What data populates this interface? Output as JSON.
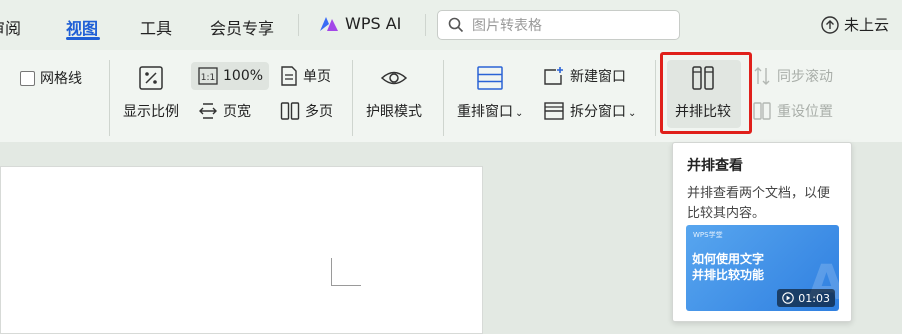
{
  "tabs": {
    "review_partial": "审阅",
    "view": "视图",
    "tools": "工具",
    "member": "会员专享",
    "wps_ai": "WPS AI"
  },
  "search": {
    "placeholder": "图片转表格"
  },
  "cloud": {
    "label": "未上云"
  },
  "ribbon": {
    "gridlines": "网格线",
    "zoom_ratio": "显示比例",
    "zoom_100": "100%",
    "page_width": "页宽",
    "single_page": "单页",
    "multi_page": "多页",
    "eye_protect": "护眼模式",
    "rearrange_windows": "重排窗口",
    "new_window": "新建窗口",
    "split_window": "拆分窗口",
    "side_by_side": "并排比较",
    "sync_scroll": "同步滚动",
    "reset_position": "重设位置"
  },
  "tooltip": {
    "title": "并排查看",
    "description": "并排查看两个文档，以便比较其内容。",
    "video_brand": "WPS学堂",
    "video_title_line1": "如何使用文字",
    "video_title_line2": "并排比较功能",
    "video_duration": "01:03"
  },
  "colors": {
    "accent_blue": "#1f5fd6",
    "highlight_red": "#e0201b",
    "ribbon_bg": "#f1f5f1",
    "video_blue": "#3f8ee6"
  },
  "icons": [
    "ai-logo-icon",
    "search-icon",
    "cloud-upload-icon",
    "checkbox-icon",
    "zoom-percent-icon",
    "actual-size-icon",
    "page-width-icon",
    "single-page-icon",
    "multi-page-icon",
    "eye-icon",
    "rearrange-icon",
    "new-window-icon",
    "split-window-icon",
    "side-by-side-icon",
    "sync-scroll-icon",
    "reset-position-icon",
    "play-icon"
  ]
}
